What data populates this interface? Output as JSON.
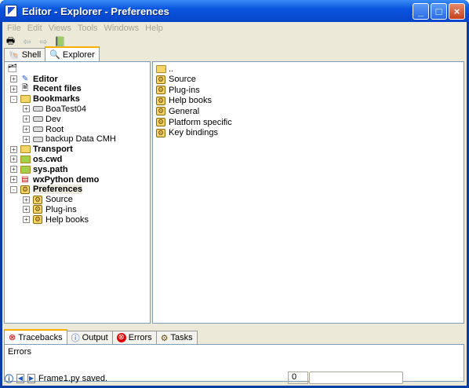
{
  "window": {
    "title": "Editor - Explorer - Preferences"
  },
  "menu": [
    "File",
    "Edit",
    "Views",
    "Tools",
    "Windows",
    "Help"
  ],
  "tabs": {
    "shell": "Shell",
    "explorer": "Explorer"
  },
  "tree": [
    {
      "label": "Editor",
      "bold": true,
      "depth": 0,
      "expander": "+",
      "icon": "editor-icon"
    },
    {
      "label": "Recent files",
      "bold": true,
      "depth": 0,
      "expander": "+",
      "icon": "recent-files-icon"
    },
    {
      "label": "Bookmarks",
      "bold": true,
      "depth": 0,
      "expander": "-",
      "icon": "folder-icon"
    },
    {
      "label": "BoaTest04",
      "depth": 1,
      "expander": "+",
      "icon": "drive-icon"
    },
    {
      "label": "Dev",
      "depth": 1,
      "expander": "+",
      "icon": "drive-icon"
    },
    {
      "label": "Root",
      "depth": 1,
      "expander": "+",
      "icon": "drive-icon"
    },
    {
      "label": "backup Data CMH",
      "depth": 1,
      "expander": "+",
      "icon": "drive-icon"
    },
    {
      "label": "Transport",
      "bold": true,
      "depth": 0,
      "expander": "+",
      "icon": "folder-icon"
    },
    {
      "label": "os.cwd",
      "bold": true,
      "depth": 0,
      "expander": "+",
      "icon": "folder-green-icon"
    },
    {
      "label": "sys.path",
      "bold": true,
      "depth": 0,
      "expander": "+",
      "icon": "folder-green-icon"
    },
    {
      "label": "wxPython demo",
      "bold": true,
      "depth": 0,
      "expander": "+",
      "icon": "demo-icon"
    },
    {
      "label": "Preferences",
      "bold": true,
      "depth": 0,
      "expander": "-",
      "icon": "gear-icon",
      "selected": true
    },
    {
      "label": "Source",
      "depth": 1,
      "expander": "+",
      "icon": "gear-icon"
    },
    {
      "label": "Plug-ins",
      "depth": 1,
      "expander": "+",
      "icon": "gear-icon"
    },
    {
      "label": "Help books",
      "depth": 1,
      "expander": "+",
      "icon": "gear-icon"
    }
  ],
  "list": [
    {
      "label": "..",
      "icon": "folder-up-icon"
    },
    {
      "label": "Source",
      "icon": "gear-icon"
    },
    {
      "label": "Plug-ins",
      "icon": "gear-icon"
    },
    {
      "label": "Help books",
      "icon": "gear-icon"
    },
    {
      "label": "General",
      "icon": "preferences-icon"
    },
    {
      "label": "Platform specific",
      "icon": "preferences-icon"
    },
    {
      "label": "Key bindings",
      "icon": "preferences-icon"
    }
  ],
  "bottom_tabs": [
    {
      "label": "Tracebacks",
      "icon": "tracebacks-icon",
      "active": true
    },
    {
      "label": "Output",
      "icon": "info-icon"
    },
    {
      "label": "Errors",
      "icon": "error-icon"
    },
    {
      "label": "Tasks",
      "icon": "tasks-icon"
    }
  ],
  "bottom": {
    "content": "Errors"
  },
  "status": {
    "message": "Frame1.py saved.",
    "line": "0",
    "field": ""
  }
}
